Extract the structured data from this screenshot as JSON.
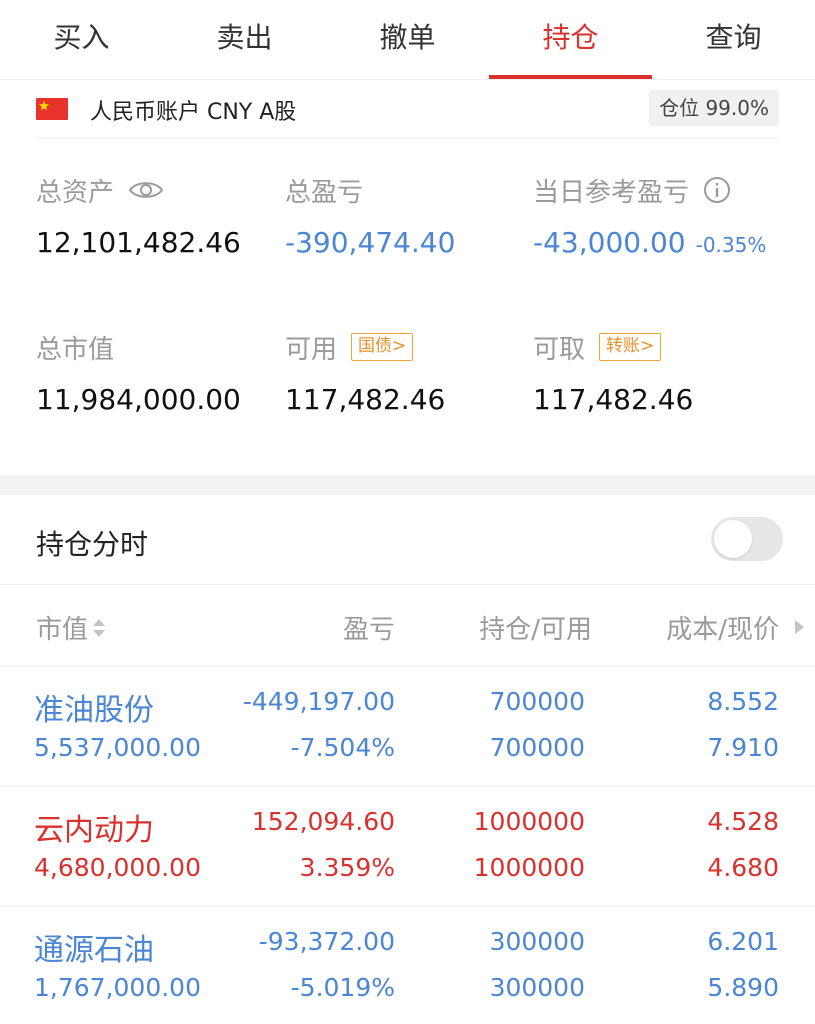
{
  "tabs": [
    {
      "label": "买入",
      "active": false
    },
    {
      "label": "卖出",
      "active": false
    },
    {
      "label": "撤单",
      "active": false
    },
    {
      "label": "持仓",
      "active": true
    },
    {
      "label": "查询",
      "active": false
    }
  ],
  "account": {
    "flag_icon": "china-flag-icon",
    "label": "人民币账户 CNY A股",
    "position_badge": "仓位 99.0%"
  },
  "summary": {
    "total_assets_label": "总资产",
    "total_assets_value": "12,101,482.46",
    "total_pnl_label": "总盈亏",
    "total_pnl_value": "-390,474.40",
    "daily_pnl_label": "当日参考盈亏",
    "daily_pnl_value": "-43,000.00",
    "daily_pnl_pct": "-0.35%",
    "market_value_label": "总市值",
    "market_value_value": "11,984,000.00",
    "available_label": "可用",
    "available_tag": "国债>",
    "available_value": "117,482.46",
    "withdrawable_label": "可取",
    "withdrawable_tag": "转账>",
    "withdrawable_value": "117,482.46"
  },
  "position_chart_toggle": {
    "label": "持仓分时",
    "on": false
  },
  "table": {
    "headers": {
      "market_value": "市值",
      "pnl": "盈亏",
      "holding": "持仓/可用",
      "cost_price": "成本/现价"
    },
    "rows": [
      {
        "name": "准油股份",
        "market_value": "5,537,000.00",
        "pnl": "-449,197.00",
        "pnl_pct": "-7.504%",
        "holding": "700000",
        "available": "700000",
        "cost": "8.552",
        "price": "7.910",
        "trend": "down"
      },
      {
        "name": "云内动力",
        "market_value": "4,680,000.00",
        "pnl": "152,094.60",
        "pnl_pct": "3.359%",
        "holding": "1000000",
        "available": "1000000",
        "cost": "4.528",
        "price": "4.680",
        "trend": "up"
      },
      {
        "name": "通源石油",
        "market_value": "1,767,000.00",
        "pnl": "-93,372.00",
        "pnl_pct": "-5.019%",
        "holding": "300000",
        "available": "300000",
        "cost": "6.201",
        "price": "5.890",
        "trend": "down"
      }
    ]
  },
  "colors": {
    "accent_red": "#d9312e",
    "loss_blue": "#4a86d4",
    "tag_orange": "#e8912a"
  }
}
